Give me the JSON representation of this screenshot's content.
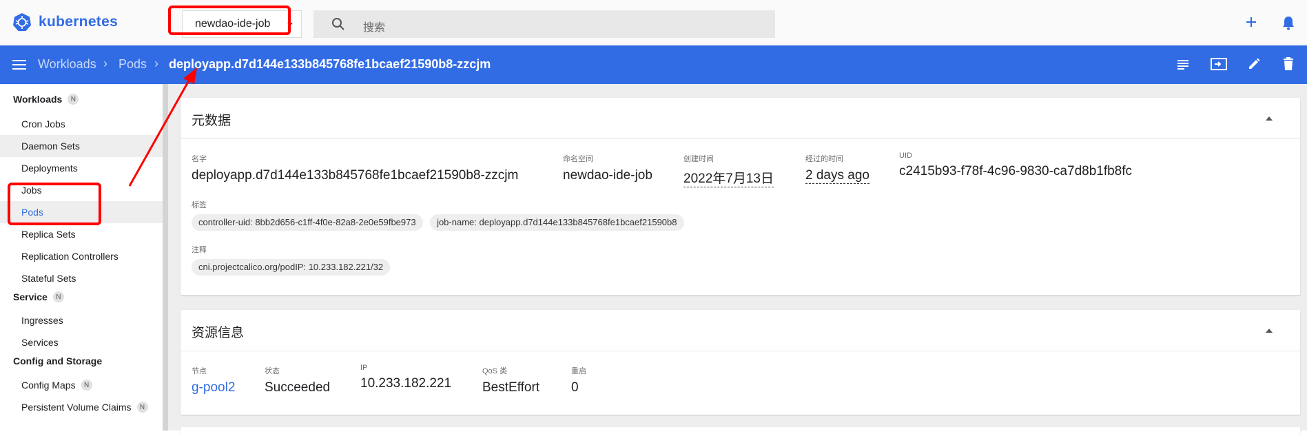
{
  "topbar": {
    "brand": "kubernetes",
    "namespace": "newdao-ide-job",
    "search_placeholder": "搜索"
  },
  "breadcrumb": {
    "items": [
      "Workloads",
      "Pods"
    ],
    "current": "deployapp.d7d144e133b845768fe1bcaef21590b8-zzcjm"
  },
  "sidebar": {
    "sections": [
      {
        "label": "Workloads",
        "badge": "N"
      },
      {
        "label": "Service",
        "badge": "N"
      },
      {
        "label": "Config and Storage",
        "badge": ""
      }
    ],
    "workload_items": [
      "Cron Jobs",
      "Daemon Sets",
      "Deployments",
      "Jobs",
      "Pods",
      "Replica Sets",
      "Replication Controllers",
      "Stateful Sets"
    ],
    "service_items": [
      "Ingresses",
      "Services"
    ],
    "config_items": [
      {
        "label": "Config Maps",
        "badge": "N"
      },
      {
        "label": "Persistent Volume Claims",
        "badge": "N"
      }
    ]
  },
  "metadata": {
    "title": "元数据",
    "name_label": "名字",
    "name": "deployapp.d7d144e133b845768fe1bcaef21590b8-zzcjm",
    "namespace_label": "命名空间",
    "namespace": "newdao-ide-job",
    "created_label": "创建时间",
    "created": "2022年7月13日",
    "age_label": "经过的时间",
    "age": "2 days ago",
    "uid_label": "UID",
    "uid": "c2415b93-f78f-4c96-9830-ca7d8b1fb8fc",
    "labels_label": "标签",
    "labels": [
      "controller-uid: 8bb2d656-c1ff-4f0e-82a8-2e0e59fbe973",
      "job-name: deployapp.d7d144e133b845768fe1bcaef21590b8"
    ],
    "annotations_label": "注释",
    "annotations": [
      "cni.projectcalico.org/podIP: 10.233.182.221/32"
    ]
  },
  "resource": {
    "title": "资源信息",
    "node_label": "节点",
    "node": "g-pool2",
    "status_label": "状态",
    "status": "Succeeded",
    "ip_label": "IP",
    "ip": "10.233.182.221",
    "qos_label": "QoS 类",
    "qos": "BestEffort",
    "restarts_label": "重启",
    "restarts": "0"
  },
  "colors": {
    "accent": "#326ce5",
    "annotation": "#ff0000"
  }
}
